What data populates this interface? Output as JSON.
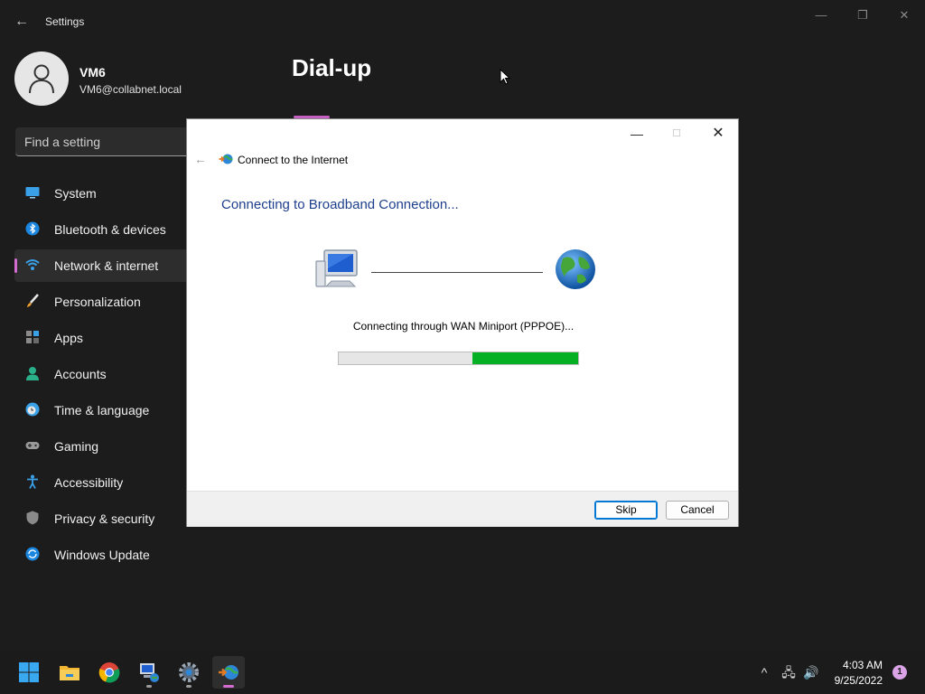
{
  "window": {
    "title": "Settings",
    "back_glyph": "←",
    "minimize_glyph": "—",
    "maximize_glyph": "❐",
    "close_glyph": "✕"
  },
  "profile": {
    "name": "VM6",
    "email": "VM6@collabnet.local"
  },
  "search": {
    "placeholder": "Find a setting"
  },
  "nav": {
    "items": [
      {
        "label": "System",
        "icon": "monitor-icon"
      },
      {
        "label": "Bluetooth & devices",
        "icon": "bluetooth-icon"
      },
      {
        "label": "Network & internet",
        "icon": "wifi-icon",
        "active": true
      },
      {
        "label": "Personalization",
        "icon": "brush-icon"
      },
      {
        "label": "Apps",
        "icon": "apps-icon"
      },
      {
        "label": "Accounts",
        "icon": "person-icon"
      },
      {
        "label": "Time & language",
        "icon": "clock-globe-icon"
      },
      {
        "label": "Gaming",
        "icon": "gamepad-icon"
      },
      {
        "label": "Accessibility",
        "icon": "accessibility-icon"
      },
      {
        "label": "Privacy & security",
        "icon": "shield-icon"
      },
      {
        "label": "Windows Update",
        "icon": "update-icon"
      }
    ]
  },
  "page": {
    "title": "Dial-up"
  },
  "dialog": {
    "app_title": "Connect to the Internet",
    "heading": "Connecting to Broadband Connection...",
    "status": "Connecting through WAN Miniport (PPPOE)...",
    "progress": {
      "segment_start": 0.56,
      "segment_end": 1.0
    },
    "minimize_glyph": "—",
    "maximize_glyph": "☐",
    "close_glyph": "✕",
    "back_glyph": "←",
    "skip_label": "Skip",
    "cancel_label": "Cancel"
  },
  "taskbar": {
    "apps": [
      {
        "name": "start-button",
        "icon": "windows-logo-icon"
      },
      {
        "name": "file-explorer",
        "icon": "folder-icon"
      },
      {
        "name": "chrome",
        "icon": "chrome-icon"
      },
      {
        "name": "remote-desktop",
        "icon": "network-pc-icon"
      },
      {
        "name": "settings",
        "icon": "gear-icon"
      },
      {
        "name": "connect-to-internet",
        "icon": "dialup-icon",
        "active": true
      }
    ],
    "tray": {
      "chevron_glyph": "^",
      "network_glyph": "🖧",
      "volume_glyph": "🔊",
      "time": "4:03 AM",
      "date": "9/25/2022",
      "notification_count": "1"
    }
  },
  "colors": {
    "accent": "#d46bd0",
    "progress_fill": "#06b025",
    "dialog_heading": "#1e3f8c"
  }
}
